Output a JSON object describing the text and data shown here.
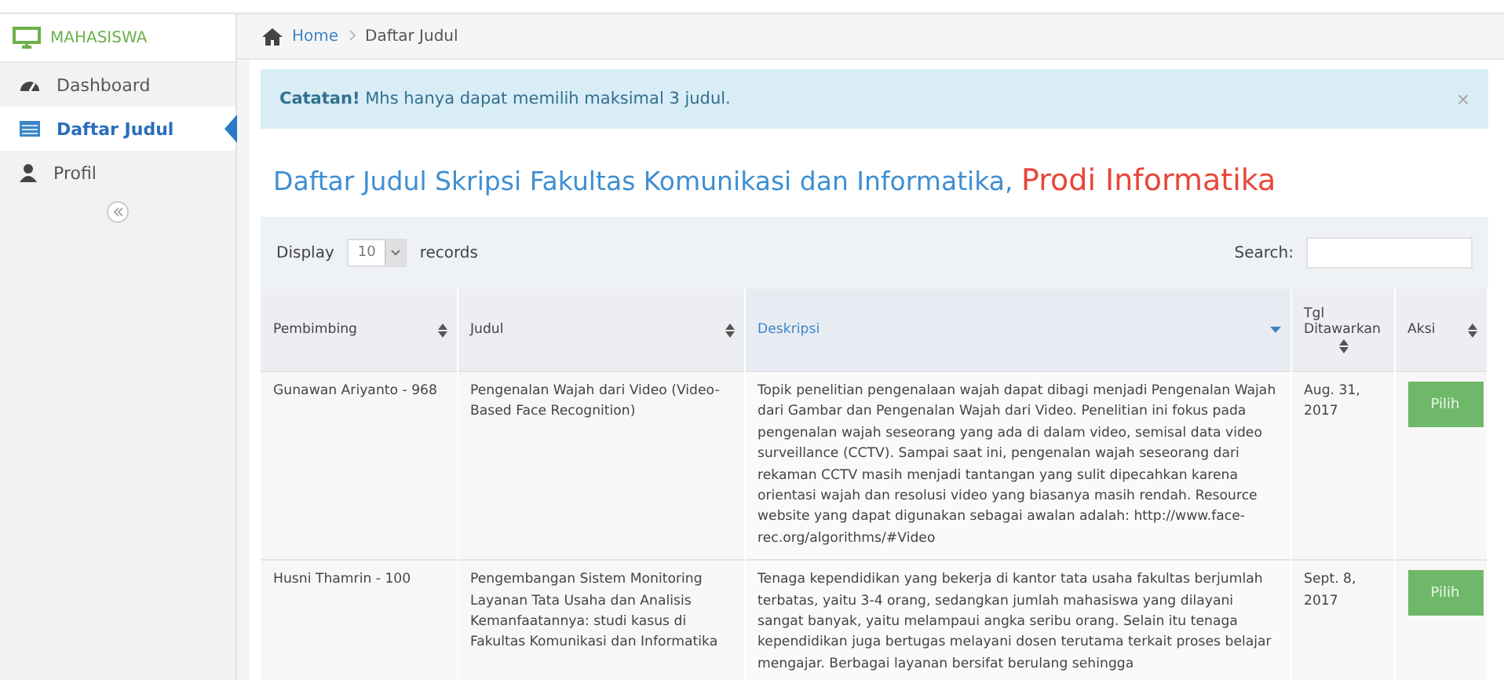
{
  "sidebar": {
    "header": "MAHASISWA",
    "items": [
      {
        "label": "Dashboard",
        "selected": false
      },
      {
        "label": "Daftar Judul",
        "selected": true
      },
      {
        "label": "Profil",
        "selected": false
      }
    ]
  },
  "breadcrumb": [
    {
      "label": "Home",
      "kind": "link"
    },
    {
      "label": "Daftar Judul",
      "kind": "current"
    }
  ],
  "alert": {
    "text": "**Catatan!** Mhs hanya dapat memilih maksimal 3 judul.",
    "close": "×"
  },
  "heading": {
    "main": "Daftar Judul Skripsi Fakultas Komunikasi dan Informatika,",
    "highlight": "Prodi Informatika"
  },
  "table_controls": {
    "display_label": "Display",
    "page_size": "10",
    "records_label": "records",
    "search_label": "Search:"
  },
  "table": {
    "columns": [
      {
        "label": "Pembimbing",
        "sorted": false
      },
      {
        "label": "Judul",
        "sorted": false
      },
      {
        "label": "Deskripsi",
        "sorted": true
      },
      {
        "label": "Tgl Ditawarkan",
        "sorted": false
      },
      {
        "label": "Aksi",
        "sorted": false
      }
    ],
    "rows": [
      {
        "pembimbing": "Gunawan Ariyanto - 968",
        "judul": "Pengenalan Wajah dari Video (Video-Based Face Recognition)",
        "deskripsi": "Topik penelitian pengenalaan wajah dapat dibagi menjadi Pengenalan Wajah dari Gambar dan Pengenalan Wajah dari Video. Penelitian ini fokus pada pengenalan wajah seseorang yang ada di dalam video, semisal data video surveillance (CCTV). Sampai saat ini, pengenalan wajah seseorang dari rekaman CCTV masih menjadi tantangan yang sulit dipecahkan karena orientasi wajah dan resolusi video yang biasanya masih rendah. Resource website yang dapat digunakan sebagai awalan adalah: http://www.face-rec.org/algorithms/#Video",
        "tgl": "Aug. 31, 2017",
        "action": "Pilih"
      },
      {
        "pembimbing": "Husni Thamrin - 100",
        "judul": "Pengembangan Sistem Monitoring Layanan Tata Usaha dan Analisis Kemanfaatannya: studi kasus di Fakultas Komunikasi dan Informatika",
        "deskripsi": "Tenaga kependidikan yang bekerja di kantor tata usaha fakultas berjumlah terbatas, yaitu 3-4 orang, sedangkan jumlah mahasiswa yang dilayani sangat banyak, yaitu melampaui angka seribu orang. Selain itu tenaga kependidikan juga bertugas melayani dosen terutama terkait proses belajar mengajar. Berbagai layanan bersifat berulang sehingga",
        "tgl": "Sept. 8, 2017",
        "action": "Pilih"
      }
    ]
  }
}
